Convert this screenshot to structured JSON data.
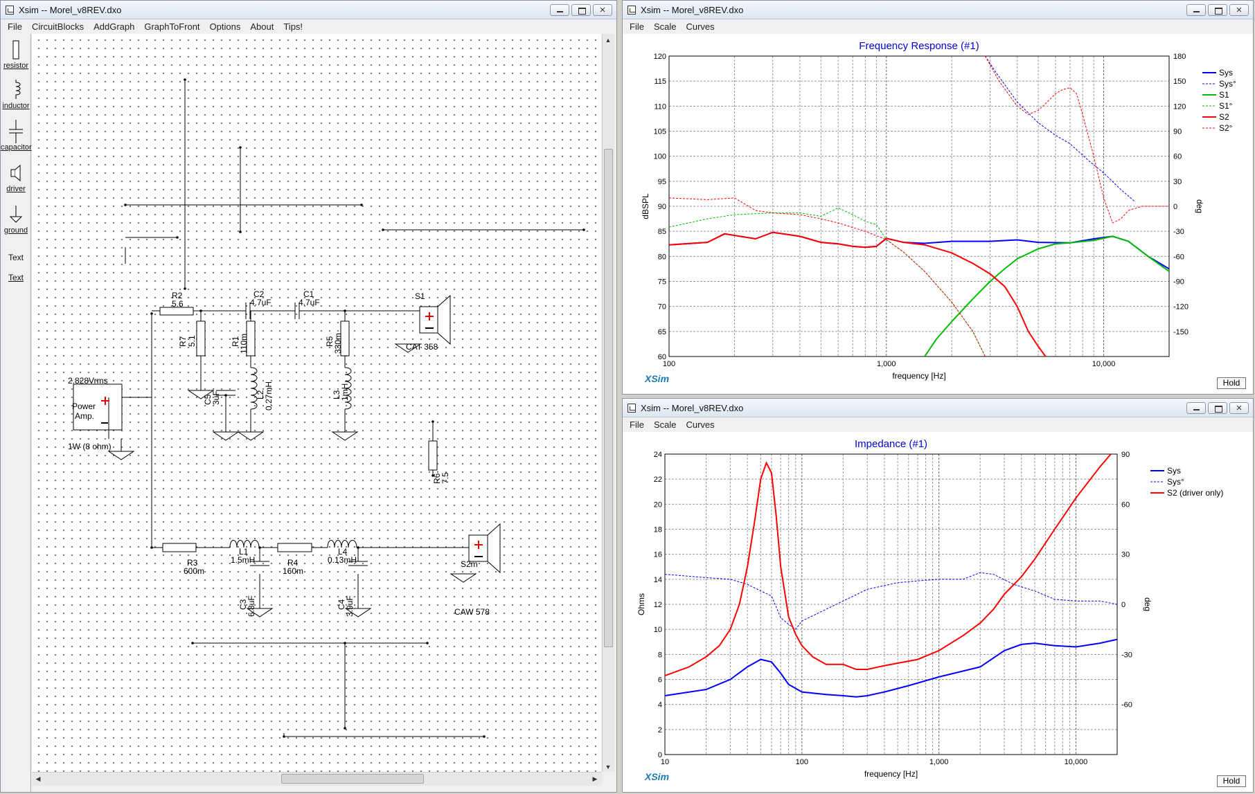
{
  "schematic": {
    "title": "Xsim -- Morel_v8REV.dxo",
    "menu": [
      "File",
      "CircuitBlocks",
      "AddGraph",
      "GraphToFront",
      "Options",
      "About",
      "Tips!"
    ],
    "tools": [
      "resistor",
      "inductor",
      "capacitor",
      "driver",
      "ground",
      "Text",
      "Text"
    ],
    "labels": {
      "r2_name": "R2",
      "r2_val": "5.6",
      "c2_name": "C2",
      "c2_val": "4.7uF",
      "c1_name": "C1",
      "c1_val": "4.7uF",
      "s1_name": "S1",
      "s1_model": "CAT 358",
      "r7_name": "R7",
      "r7_val": "5.1",
      "r1_name": "R1",
      "r1_val": "110m",
      "r5_name": "R5",
      "r5_val": "330m",
      "c5_name": "C5",
      "c5_val": "3uF",
      "l2_name": "L2",
      "l2_val": "0.27mH",
      "l3_name": "L3",
      "l3_val": "1mH",
      "amp_voltage": "2.828Vrms",
      "amp_line1": "Power",
      "amp_line2": "Amp.",
      "amp_power": "1W (8 ohm)",
      "r6_name": "R6",
      "r6_val": "7.5",
      "r3_name": "R3",
      "r3_val": "600m",
      "l1_name": "L1",
      "l1_val": "1.5mH",
      "r4_name": "R4",
      "r4_val": "160m",
      "l4_name": "L4",
      "l4_val": "0.13mH",
      "s2_name": "S2m",
      "s2_model": "CAW 578",
      "c3_name": "C3",
      "c3_val": "6.8uF",
      "c4_name": "C4",
      "c4_val": "3.9uF"
    }
  },
  "freq_window": {
    "title": "Xsim -- Morel_v8REV.dxo",
    "menu": [
      "File",
      "Scale",
      "Curves"
    ],
    "hold_label": "Hold",
    "brand": "XSim"
  },
  "imp_window": {
    "title": "Xsim -- Morel_v8REV.dxo",
    "menu": [
      "File",
      "Scale",
      "Curves"
    ],
    "hold_label": "Hold",
    "brand": "XSim"
  },
  "chart_data": [
    {
      "type": "line",
      "title": "Frequency Response (#1)",
      "xlabel": "frequency [Hz]",
      "ylabel": "dBSPL",
      "y2label": "deg",
      "xscale": "log",
      "xlim": [
        100,
        20000
      ],
      "ylim": [
        60,
        120
      ],
      "y2lim": [
        -180,
        180
      ],
      "xticks": [
        {
          "v": 100,
          "l": "100"
        },
        {
          "v": 1000,
          "l": "1,000"
        },
        {
          "v": 10000,
          "l": "10,000"
        }
      ],
      "yticks": [
        60,
        65,
        70,
        75,
        80,
        85,
        90,
        95,
        100,
        105,
        110,
        115,
        120
      ],
      "y2ticks": [
        -150,
        -120,
        -90,
        -60,
        -30,
        0,
        30,
        60,
        90,
        120,
        150,
        180
      ],
      "grid": true,
      "legend_position": "right",
      "series": [
        {
          "name": "Sys",
          "color": "#0000ff",
          "axis": "left",
          "dash": false,
          "points": [
            [
              100,
              82.3
            ],
            [
              150,
              82.8
            ],
            [
              180,
              84.5
            ],
            [
              250,
              83.5
            ],
            [
              300,
              84.8
            ],
            [
              400,
              84
            ],
            [
              500,
              82.8
            ],
            [
              600,
              82.5
            ],
            [
              700,
              82
            ],
            [
              800,
              81.8
            ],
            [
              900,
              82
            ],
            [
              1000,
              83.6
            ],
            [
              1200,
              82.8
            ],
            [
              1500,
              82.6
            ],
            [
              2000,
              83
            ],
            [
              3000,
              83
            ],
            [
              4000,
              83.3
            ],
            [
              5000,
              82.8
            ],
            [
              7000,
              82.7
            ],
            [
              9000,
              83.5
            ],
            [
              11000,
              84
            ],
            [
              13000,
              83
            ],
            [
              16000,
              80
            ],
            [
              20000,
              77.5
            ]
          ]
        },
        {
          "name": "Sys°",
          "color": "#0000ff",
          "axis": "right",
          "dash": true,
          "points": [
            [
              2850,
              180
            ],
            [
              3200,
              160
            ],
            [
              4000,
              125
            ],
            [
              5000,
              100
            ],
            [
              6000,
              85
            ],
            [
              7000,
              75
            ],
            [
              8500,
              55
            ],
            [
              10000,
              40
            ],
            [
              12000,
              20
            ],
            [
              14000,
              5
            ]
          ]
        },
        {
          "name": "S1",
          "color": "#00bb00",
          "axis": "left",
          "dash": false,
          "points": [
            [
              1500,
              60
            ],
            [
              1700,
              63.5
            ],
            [
              2000,
              67
            ],
            [
              2500,
              71.5
            ],
            [
              3000,
              75
            ],
            [
              3500,
              77.5
            ],
            [
              4000,
              79.5
            ],
            [
              5000,
              81.5
            ],
            [
              6000,
              82.5
            ],
            [
              7000,
              82.7
            ],
            [
              9000,
              83.2
            ],
            [
              11000,
              84
            ],
            [
              13000,
              83
            ],
            [
              16000,
              80
            ],
            [
              20000,
              77
            ]
          ]
        },
        {
          "name": "S1°",
          "color": "#00bb00",
          "axis": "right",
          "dash": true,
          "points": [
            [
              100,
              -25
            ],
            [
              150,
              -15
            ],
            [
              200,
              -10
            ],
            [
              300,
              -8
            ],
            [
              400,
              -8
            ],
            [
              500,
              -12
            ],
            [
              600,
              -2
            ],
            [
              700,
              -10
            ],
            [
              800,
              -18
            ],
            [
              900,
              -22
            ],
            [
              1000,
              -40
            ],
            [
              1200,
              -55
            ],
            [
              1500,
              -78
            ],
            [
              2000,
              -115
            ],
            [
              2500,
              -150
            ],
            [
              2850,
              -180
            ]
          ]
        },
        {
          "name": "S2",
          "color": "#ff0000",
          "axis": "left",
          "dash": false,
          "points": [
            [
              100,
              82.3
            ],
            [
              150,
              82.8
            ],
            [
              180,
              84.5
            ],
            [
              250,
              83.5
            ],
            [
              300,
              84.8
            ],
            [
              400,
              84
            ],
            [
              500,
              82.8
            ],
            [
              600,
              82.5
            ],
            [
              700,
              82
            ],
            [
              800,
              81.8
            ],
            [
              900,
              82
            ],
            [
              1000,
              83.6
            ],
            [
              1200,
              82.8
            ],
            [
              1500,
              82.3
            ],
            [
              2000,
              80.7
            ],
            [
              2500,
              78.6
            ],
            [
              3000,
              76.5
            ],
            [
              3500,
              74
            ],
            [
              4000,
              70
            ],
            [
              4500,
              65
            ],
            [
              5000,
              62
            ],
            [
              5400,
              60
            ]
          ]
        },
        {
          "name": "S2°",
          "color": "#ff0000",
          "axis": "right",
          "dash": true,
          "points": [
            [
              100,
              10
            ],
            [
              150,
              8
            ],
            [
              200,
              10
            ],
            [
              250,
              -5
            ],
            [
              300,
              -8
            ],
            [
              400,
              -10
            ],
            [
              500,
              -15
            ],
            [
              600,
              -20
            ],
            [
              800,
              -30
            ],
            [
              1000,
              -40
            ],
            [
              1200,
              -55
            ],
            [
              1500,
              -78
            ],
            [
              2000,
              -115
            ],
            [
              2500,
              -150
            ],
            [
              2850,
              -180
            ],
            [
              2850,
              180
            ],
            [
              3300,
              150
            ],
            [
              4000,
              120
            ],
            [
              4500,
              110
            ],
            [
              5000,
              115
            ],
            [
              5500,
              125
            ],
            [
              6000,
              135
            ],
            [
              6500,
              140
            ],
            [
              7000,
              142
            ],
            [
              7500,
              135
            ],
            [
              8000,
              110
            ],
            [
              9000,
              60
            ],
            [
              10000,
              10
            ],
            [
              11000,
              -20
            ],
            [
              12000,
              -15
            ],
            [
              13000,
              -5
            ],
            [
              15000,
              0
            ],
            [
              20000,
              0
            ]
          ]
        }
      ]
    },
    {
      "type": "line",
      "title": "Impedance (#1)",
      "xlabel": "frequency [Hz]",
      "ylabel": "Ohms",
      "y2label": "deg",
      "xscale": "log",
      "xlim": [
        10,
        20000
      ],
      "ylim": [
        0,
        24
      ],
      "y2lim": [
        -90,
        90
      ],
      "xticks": [
        {
          "v": 10,
          "l": "10"
        },
        {
          "v": 100,
          "l": "100"
        },
        {
          "v": 1000,
          "l": "1,000"
        },
        {
          "v": 10000,
          "l": "10,000"
        }
      ],
      "yticks": [
        0,
        2,
        4,
        6,
        8,
        10,
        12,
        14,
        16,
        18,
        20,
        22,
        24
      ],
      "y2ticks": [
        -60,
        -30,
        0,
        30,
        60,
        90
      ],
      "grid": true,
      "legend_position": "right",
      "series": [
        {
          "name": "Sys",
          "color": "#0000ff",
          "axis": "left",
          "dash": false,
          "points": [
            [
              10,
              4.7
            ],
            [
              20,
              5.2
            ],
            [
              30,
              6
            ],
            [
              40,
              7
            ],
            [
              50,
              7.6
            ],
            [
              60,
              7.4
            ],
            [
              70,
              6.5
            ],
            [
              80,
              5.6
            ],
            [
              100,
              5
            ],
            [
              150,
              4.8
            ],
            [
              200,
              4.7
            ],
            [
              250,
              4.6
            ],
            [
              300,
              4.7
            ],
            [
              400,
              5
            ],
            [
              600,
              5.5
            ],
            [
              1000,
              6.2
            ],
            [
              2000,
              7
            ],
            [
              3000,
              8.3
            ],
            [
              4000,
              8.8
            ],
            [
              5000,
              8.9
            ],
            [
              7000,
              8.7
            ],
            [
              10000,
              8.6
            ],
            [
              15000,
              8.9
            ],
            [
              20000,
              9.2
            ]
          ]
        },
        {
          "name": "Sys°",
          "color": "#0000ff",
          "axis": "right",
          "dash": true,
          "points": [
            [
              10,
              18
            ],
            [
              20,
              16
            ],
            [
              30,
              15
            ],
            [
              40,
              12
            ],
            [
              50,
              8
            ],
            [
              60,
              5
            ],
            [
              70,
              -8
            ],
            [
              80,
              -12
            ],
            [
              90,
              -15
            ],
            [
              100,
              -10
            ],
            [
              150,
              -3
            ],
            [
              200,
              2
            ],
            [
              300,
              9
            ],
            [
              500,
              13
            ],
            [
              700,
              14
            ],
            [
              1000,
              15
            ],
            [
              1500,
              15
            ],
            [
              2000,
              19
            ],
            [
              2500,
              18
            ],
            [
              3500,
              12
            ],
            [
              5000,
              8
            ],
            [
              7000,
              3
            ],
            [
              10000,
              2
            ],
            [
              15000,
              2
            ],
            [
              20000,
              0
            ]
          ]
        },
        {
          "name": "S2 (driver only)",
          "color": "#ff0000",
          "axis": "left",
          "dash": false,
          "points": [
            [
              10,
              6.3
            ],
            [
              15,
              7
            ],
            [
              20,
              7.8
            ],
            [
              25,
              8.7
            ],
            [
              30,
              10
            ],
            [
              35,
              12
            ],
            [
              40,
              15
            ],
            [
              45,
              18.5
            ],
            [
              50,
              22
            ],
            [
              55,
              23.3
            ],
            [
              60,
              22.5
            ],
            [
              65,
              19
            ],
            [
              70,
              15
            ],
            [
              80,
              11
            ],
            [
              90,
              9.6
            ],
            [
              100,
              8.7
            ],
            [
              120,
              7.8
            ],
            [
              150,
              7.2
            ],
            [
              200,
              7.2
            ],
            [
              250,
              6.8
            ],
            [
              300,
              6.8
            ],
            [
              400,
              7.1
            ],
            [
              500,
              7.3
            ],
            [
              700,
              7.6
            ],
            [
              1000,
              8.3
            ],
            [
              1500,
              9.5
            ],
            [
              2000,
              10.5
            ],
            [
              2500,
              11.6
            ],
            [
              3000,
              12.8
            ],
            [
              4000,
              14.2
            ],
            [
              5000,
              15.6
            ],
            [
              7000,
              18
            ],
            [
              10000,
              20.5
            ],
            [
              15000,
              23
            ],
            [
              18000,
              24
            ]
          ]
        }
      ]
    }
  ]
}
